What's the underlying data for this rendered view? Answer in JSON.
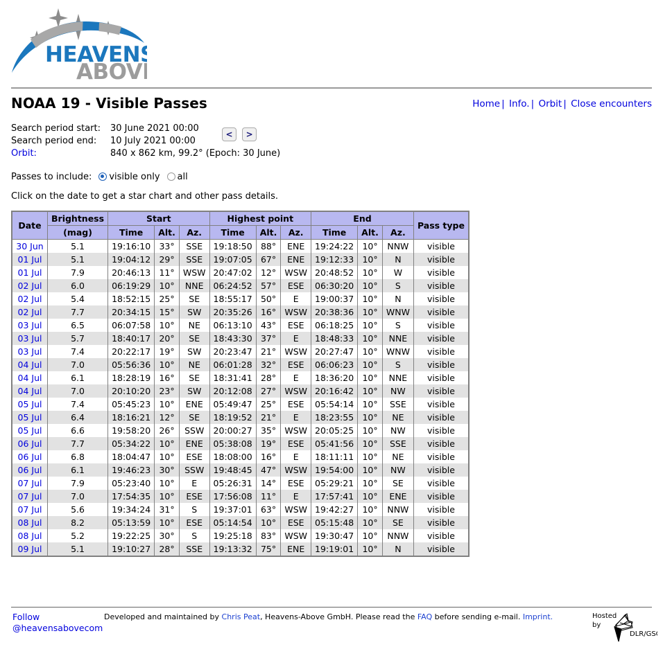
{
  "brand": {
    "name_top": "HEAVENS",
    "name_bottom": "ABOVE",
    "color_blue": "#1b77bd",
    "color_gray": "#9c9c9c"
  },
  "header": {
    "title": "NOAA 19 - Visible Passes",
    "nav": [
      {
        "label": "Home"
      },
      {
        "label": "Info."
      },
      {
        "label": "Orbit"
      },
      {
        "label": "Close encounters"
      }
    ],
    "nav_separator": "|"
  },
  "search_period": {
    "start_label": "Search period start:",
    "start_value": "30 June 2021 00:00",
    "end_label": "Search period end:",
    "end_value": "10 July 2021 00:00",
    "orbit_label": "Orbit:",
    "orbit_value": "840 x 862 km, 99.2° (Epoch: 30 June)",
    "prev_button": "<",
    "next_button": ">"
  },
  "passes_filter": {
    "label": "Passes to include:",
    "options": [
      {
        "label": "visible only",
        "selected": true
      },
      {
        "label": "all",
        "selected": false
      }
    ]
  },
  "hint": "Click on the date to get a star chart and other pass details.",
  "table": {
    "group_headers": {
      "date": "Date",
      "brightness_line1": "Brightness",
      "brightness_line2": "(mag)",
      "start": "Start",
      "highest_point": "Highest point",
      "end": "End",
      "pass_type": "Pass type"
    },
    "sub_headers": {
      "time": "Time",
      "alt": "Alt.",
      "az": "Az."
    },
    "rows": [
      {
        "date": "30 Jun",
        "mag": "5.1",
        "s_time": "19:16:10",
        "s_alt": "33°",
        "s_az": "SSE",
        "h_time": "19:18:50",
        "h_alt": "88°",
        "h_az": "ENE",
        "e_time": "19:24:22",
        "e_alt": "10°",
        "e_az": "NNW",
        "type": "visible"
      },
      {
        "date": "01 Jul",
        "mag": "5.1",
        "s_time": "19:04:12",
        "s_alt": "29°",
        "s_az": "SSE",
        "h_time": "19:07:05",
        "h_alt": "67°",
        "h_az": "ENE",
        "e_time": "19:12:33",
        "e_alt": "10°",
        "e_az": "N",
        "type": "visible"
      },
      {
        "date": "01 Jul",
        "mag": "7.9",
        "s_time": "20:46:13",
        "s_alt": "11°",
        "s_az": "WSW",
        "h_time": "20:47:02",
        "h_alt": "12°",
        "h_az": "WSW",
        "e_time": "20:48:52",
        "e_alt": "10°",
        "e_az": "W",
        "type": "visible"
      },
      {
        "date": "02 Jul",
        "mag": "6.0",
        "s_time": "06:19:29",
        "s_alt": "10°",
        "s_az": "NNE",
        "h_time": "06:24:52",
        "h_alt": "57°",
        "h_az": "ESE",
        "e_time": "06:30:20",
        "e_alt": "10°",
        "e_az": "S",
        "type": "visible"
      },
      {
        "date": "02 Jul",
        "mag": "5.4",
        "s_time": "18:52:15",
        "s_alt": "25°",
        "s_az": "SE",
        "h_time": "18:55:17",
        "h_alt": "50°",
        "h_az": "E",
        "e_time": "19:00:37",
        "e_alt": "10°",
        "e_az": "N",
        "type": "visible"
      },
      {
        "date": "02 Jul",
        "mag": "7.7",
        "s_time": "20:34:15",
        "s_alt": "15°",
        "s_az": "SW",
        "h_time": "20:35:26",
        "h_alt": "16°",
        "h_az": "WSW",
        "e_time": "20:38:36",
        "e_alt": "10°",
        "e_az": "WNW",
        "type": "visible"
      },
      {
        "date": "03 Jul",
        "mag": "6.5",
        "s_time": "06:07:58",
        "s_alt": "10°",
        "s_az": "NE",
        "h_time": "06:13:10",
        "h_alt": "43°",
        "h_az": "ESE",
        "e_time": "06:18:25",
        "e_alt": "10°",
        "e_az": "S",
        "type": "visible"
      },
      {
        "date": "03 Jul",
        "mag": "5.7",
        "s_time": "18:40:17",
        "s_alt": "20°",
        "s_az": "SE",
        "h_time": "18:43:30",
        "h_alt": "37°",
        "h_az": "E",
        "e_time": "18:48:33",
        "e_alt": "10°",
        "e_az": "NNE",
        "type": "visible"
      },
      {
        "date": "03 Jul",
        "mag": "7.4",
        "s_time": "20:22:17",
        "s_alt": "19°",
        "s_az": "SW",
        "h_time": "20:23:47",
        "h_alt": "21°",
        "h_az": "WSW",
        "e_time": "20:27:47",
        "e_alt": "10°",
        "e_az": "WNW",
        "type": "visible"
      },
      {
        "date": "04 Jul",
        "mag": "7.0",
        "s_time": "05:56:36",
        "s_alt": "10°",
        "s_az": "NE",
        "h_time": "06:01:28",
        "h_alt": "32°",
        "h_az": "ESE",
        "e_time": "06:06:23",
        "e_alt": "10°",
        "e_az": "S",
        "type": "visible"
      },
      {
        "date": "04 Jul",
        "mag": "6.1",
        "s_time": "18:28:19",
        "s_alt": "16°",
        "s_az": "SE",
        "h_time": "18:31:41",
        "h_alt": "28°",
        "h_az": "E",
        "e_time": "18:36:20",
        "e_alt": "10°",
        "e_az": "NNE",
        "type": "visible"
      },
      {
        "date": "04 Jul",
        "mag": "7.0",
        "s_time": "20:10:20",
        "s_alt": "23°",
        "s_az": "SW",
        "h_time": "20:12:08",
        "h_alt": "27°",
        "h_az": "WSW",
        "e_time": "20:16:42",
        "e_alt": "10°",
        "e_az": "NW",
        "type": "visible"
      },
      {
        "date": "05 Jul",
        "mag": "7.4",
        "s_time": "05:45:23",
        "s_alt": "10°",
        "s_az": "ENE",
        "h_time": "05:49:47",
        "h_alt": "25°",
        "h_az": "ESE",
        "e_time": "05:54:14",
        "e_alt": "10°",
        "e_az": "SSE",
        "type": "visible"
      },
      {
        "date": "05 Jul",
        "mag": "6.4",
        "s_time": "18:16:21",
        "s_alt": "12°",
        "s_az": "SE",
        "h_time": "18:19:52",
        "h_alt": "21°",
        "h_az": "E",
        "e_time": "18:23:55",
        "e_alt": "10°",
        "e_az": "NE",
        "type": "visible"
      },
      {
        "date": "05 Jul",
        "mag": "6.6",
        "s_time": "19:58:20",
        "s_alt": "26°",
        "s_az": "SSW",
        "h_time": "20:00:27",
        "h_alt": "35°",
        "h_az": "WSW",
        "e_time": "20:05:25",
        "e_alt": "10°",
        "e_az": "NW",
        "type": "visible"
      },
      {
        "date": "06 Jul",
        "mag": "7.7",
        "s_time": "05:34:22",
        "s_alt": "10°",
        "s_az": "ENE",
        "h_time": "05:38:08",
        "h_alt": "19°",
        "h_az": "ESE",
        "e_time": "05:41:56",
        "e_alt": "10°",
        "e_az": "SSE",
        "type": "visible"
      },
      {
        "date": "06 Jul",
        "mag": "6.8",
        "s_time": "18:04:47",
        "s_alt": "10°",
        "s_az": "ESE",
        "h_time": "18:08:00",
        "h_alt": "16°",
        "h_az": "E",
        "e_time": "18:11:11",
        "e_alt": "10°",
        "e_az": "NE",
        "type": "visible"
      },
      {
        "date": "06 Jul",
        "mag": "6.1",
        "s_time": "19:46:23",
        "s_alt": "30°",
        "s_az": "SSW",
        "h_time": "19:48:45",
        "h_alt": "47°",
        "h_az": "WSW",
        "e_time": "19:54:00",
        "e_alt": "10°",
        "e_az": "NW",
        "type": "visible"
      },
      {
        "date": "07 Jul",
        "mag": "7.9",
        "s_time": "05:23:40",
        "s_alt": "10°",
        "s_az": "E",
        "h_time": "05:26:31",
        "h_alt": "14°",
        "h_az": "ESE",
        "e_time": "05:29:21",
        "e_alt": "10°",
        "e_az": "SE",
        "type": "visible"
      },
      {
        "date": "07 Jul",
        "mag": "7.0",
        "s_time": "17:54:35",
        "s_alt": "10°",
        "s_az": "ESE",
        "h_time": "17:56:08",
        "h_alt": "11°",
        "h_az": "E",
        "e_time": "17:57:41",
        "e_alt": "10°",
        "e_az": "ENE",
        "type": "visible"
      },
      {
        "date": "07 Jul",
        "mag": "5.6",
        "s_time": "19:34:24",
        "s_alt": "31°",
        "s_az": "S",
        "h_time": "19:37:01",
        "h_alt": "63°",
        "h_az": "WSW",
        "e_time": "19:42:27",
        "e_alt": "10°",
        "e_az": "NNW",
        "type": "visible"
      },
      {
        "date": "08 Jul",
        "mag": "8.2",
        "s_time": "05:13:59",
        "s_alt": "10°",
        "s_az": "ESE",
        "h_time": "05:14:54",
        "h_alt": "10°",
        "h_az": "ESE",
        "e_time": "05:15:48",
        "e_alt": "10°",
        "e_az": "SE",
        "type": "visible"
      },
      {
        "date": "08 Jul",
        "mag": "5.2",
        "s_time": "19:22:25",
        "s_alt": "30°",
        "s_az": "S",
        "h_time": "19:25:18",
        "h_alt": "83°",
        "h_az": "WSW",
        "e_time": "19:30:47",
        "e_alt": "10°",
        "e_az": "NNW",
        "type": "visible"
      },
      {
        "date": "09 Jul",
        "mag": "5.1",
        "s_time": "19:10:27",
        "s_alt": "28°",
        "s_az": "SSE",
        "h_time": "19:13:32",
        "h_alt": "75°",
        "h_az": "ENE",
        "e_time": "19:19:01",
        "e_alt": "10°",
        "e_az": "N",
        "type": "visible"
      }
    ]
  },
  "footer": {
    "follow_label": "Follow",
    "handle": "@heavensabovecom",
    "credit_pre": "Developed and maintained by ",
    "credit_author": "Chris Peat",
    "credit_mid": ", Heavens-Above GmbH. Please read the ",
    "credit_faq": "FAQ",
    "credit_post": " before sending e-mail. ",
    "credit_imprint": "Imprint.",
    "hosted_line1": "Hosted",
    "hosted_line2": "by",
    "hosted_org": "DLR/GSOC"
  },
  "colors": {
    "table_header_bg": "#b8b8f0",
    "row_alt_bg": "#e2e2e2",
    "link": "#0000dd",
    "border": "#808080"
  }
}
